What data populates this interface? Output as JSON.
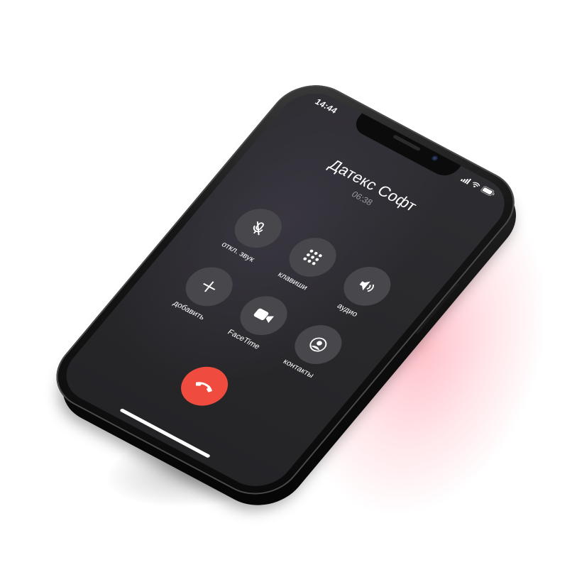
{
  "status_bar": {
    "time": "14:44"
  },
  "call": {
    "caller_name": "Датекс Софт",
    "duration": "06:38"
  },
  "controls": [
    {
      "label": "откл. звук",
      "icon": "mute-microphone-icon"
    },
    {
      "label": "клавиши",
      "icon": "keypad-icon"
    },
    {
      "label": "аудио",
      "icon": "speaker-icon"
    },
    {
      "label": "добавить",
      "icon": "plus-icon"
    },
    {
      "label": "FaceTime",
      "icon": "facetime-video-icon"
    },
    {
      "label": "контакты",
      "icon": "contact-icon"
    }
  ],
  "end_call": {
    "icon": "end-call-icon",
    "color": "#ef4c3f"
  },
  "colors": {
    "screen_background": "#28282b",
    "button_background": "#47474c",
    "end_call": "#ef4c3f",
    "accent_glow": "#ff5069"
  }
}
